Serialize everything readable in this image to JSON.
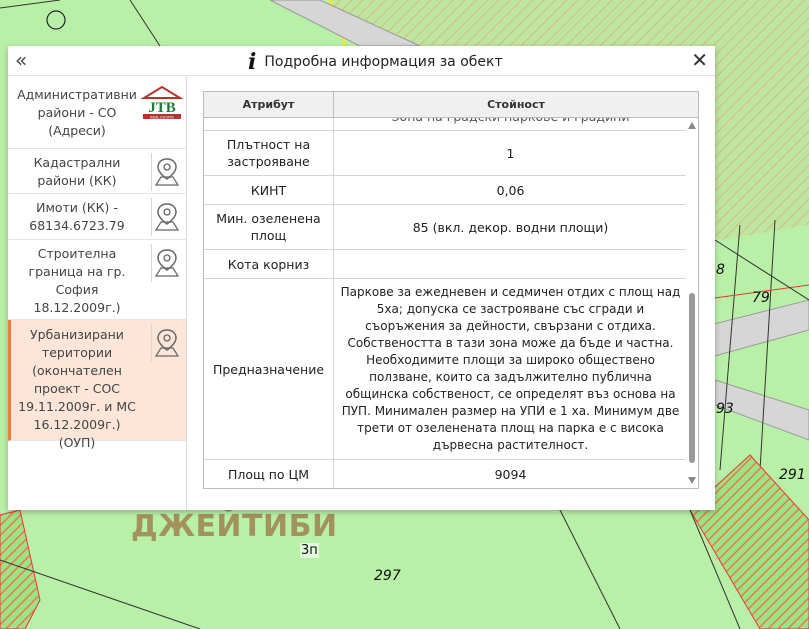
{
  "map": {
    "brand_text": "ДЖЕЙТИБИ",
    "numbers": [
      "8",
      "79",
      "93",
      "291",
      "297"
    ],
    "tag": "3п",
    "colors": {
      "green": "#b9f0a8",
      "hatch_orange": "#f07a3c",
      "hatch_yellow": "#c9d18a",
      "road": "#c8c8c8"
    }
  },
  "dialog": {
    "back_icon": "double-chevron-left-icon",
    "back_glyph": "«",
    "info_icon": "info-icon",
    "info_glyph": "i",
    "title": "Подробна информация за обект",
    "close_icon": "close-icon",
    "close_glyph": "✕"
  },
  "layers": {
    "logo_text": "JTB",
    "logo_sub": "REAL ESTATE",
    "items": [
      {
        "label": "Административни райони - СО (Адреси)",
        "has_pin": false,
        "active": false
      },
      {
        "label": "Кадастрални райони (КК)",
        "has_pin": true,
        "active": false
      },
      {
        "label": "Имоти (КК) - 68134.6723.79",
        "has_pin": true,
        "active": false
      },
      {
        "label": "Строителна граница на гр. София 18.12.2009г.) (ОУП)",
        "has_pin": true,
        "active": false
      },
      {
        "label": "Урбанизирани територии (окончателен проект - СОС 19.11.2009г. и МС 16.12.2009г.) (ОУП)",
        "has_pin": true,
        "active": true
      }
    ],
    "pin_icon": "map-pin-icon"
  },
  "table": {
    "headers": {
      "attribute": "Атрибут",
      "value": "Стойност"
    },
    "rows": [
      {
        "attr": "",
        "value": "Зона на градски паркове и градини"
      },
      {
        "attr": "Плътност на застрояване",
        "value": "1"
      },
      {
        "attr": "КИНТ",
        "value": "0,06"
      },
      {
        "attr": "Мин. озеленена площ",
        "value": "85 (вкл. декор. водни площи)"
      },
      {
        "attr": "Кота корниз",
        "value": ""
      },
      {
        "attr": "Предназначение",
        "value": "Паркове за ежедневен и седмичен отдих с площ над 5ха; допуска се застрояване със сгради и съоръжения за дейности, свързани с отдиха. Собствеността в тази зона може да бъде и частна. Необходимите площи за широко обществено ползване, които са задължително публична общинска собственост, се определят въз основа на ПУП. Минимален размер на УПИ е 1 ха. Минимум две трети от озеленената площ на парка е с висока дървесна растителност."
      },
      {
        "attr": "Площ по ЦМ",
        "value": "9094"
      }
    ]
  }
}
